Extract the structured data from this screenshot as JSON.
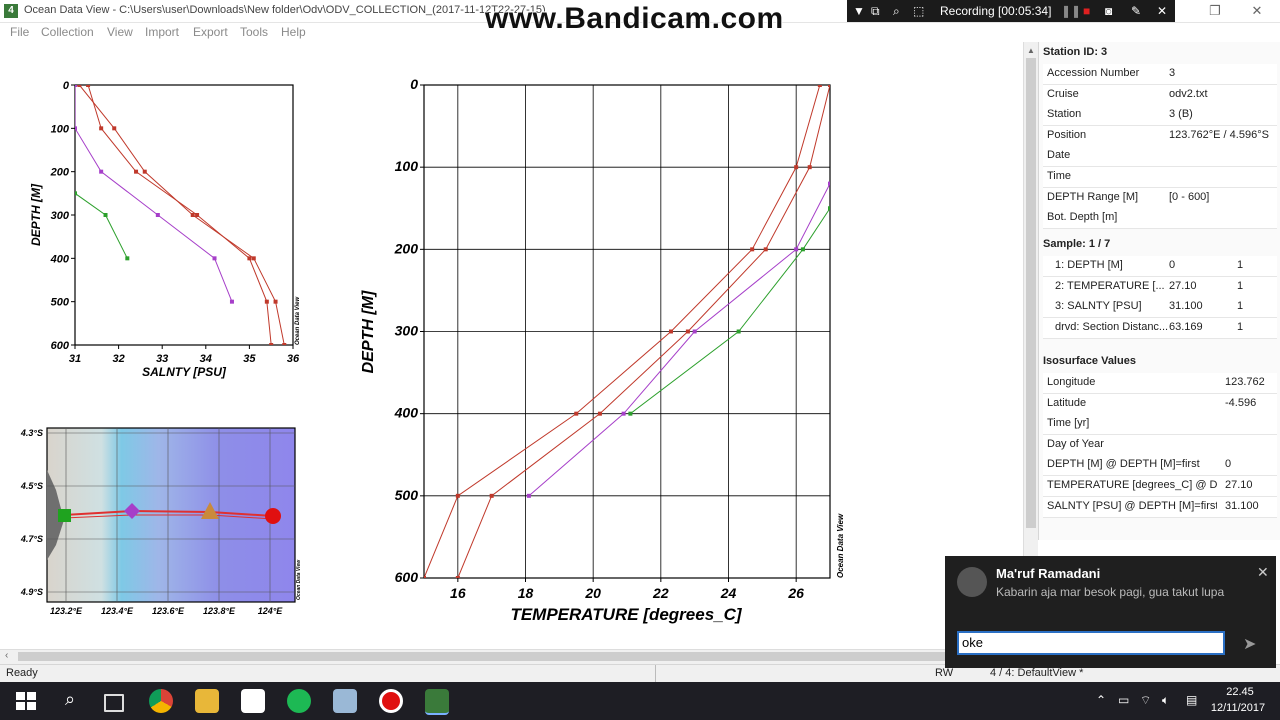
{
  "window": {
    "title": "Ocean Data View - C:\\Users\\user\\Downloads\\New folder\\Odv\\ODV_COLLECTION_(2017-11-12T22-27-15)",
    "app_icon": "4",
    "watermark": "www.Bandicam.com"
  },
  "recorder": {
    "label": "Recording [00:05:34]"
  },
  "menu": [
    "File",
    "Collection",
    "View",
    "Import",
    "Export",
    "Tools",
    "Help"
  ],
  "plots": {
    "salinity": {
      "ylabel": "DEPTH [M]",
      "xlabel": "SALNTY [PSU]",
      "watermark": "Ocean Data View",
      "xticks": [
        "31",
        "32",
        "33",
        "34",
        "35",
        "36"
      ],
      "yticks": [
        "0",
        "100",
        "200",
        "300",
        "400",
        "500",
        "600"
      ]
    },
    "temperature": {
      "ylabel": "DEPTH [M]",
      "xlabel": "TEMPERATURE [degrees_C]",
      "watermark": "Ocean Data View",
      "xticks": [
        "16",
        "18",
        "20",
        "22",
        "24",
        "26"
      ],
      "yticks": [
        "0",
        "100",
        "200",
        "300",
        "400",
        "500",
        "600"
      ]
    },
    "map": {
      "watermark": "Ocean Data View",
      "lat_ticks": [
        "4.3°S",
        "4.5°S",
        "4.7°S",
        "4.9°S"
      ],
      "lon_ticks": [
        "123.2°E",
        "123.4°E",
        "123.6°E",
        "123.8°E",
        "124°E"
      ]
    }
  },
  "chart_data": [
    {
      "type": "line",
      "xlabel": "SALNTY [PSU]",
      "ylabel": "DEPTH [M]",
      "xlim": [
        31,
        36
      ],
      "ylim": [
        600,
        0
      ],
      "series": [
        {
          "color": "#c0392b",
          "x": [
            31.1,
            31.9,
            32.6,
            33.7,
            35.1,
            35.6,
            35.8
          ],
          "y": [
            0,
            100,
            200,
            300,
            400,
            500,
            600
          ]
        },
        {
          "color": "#c0392b",
          "x": [
            31.3,
            31.6,
            32.4,
            33.8,
            35.0,
            35.4,
            35.5
          ],
          "y": [
            0,
            100,
            200,
            300,
            400,
            500,
            600
          ]
        },
        {
          "color": "#a63fc9",
          "x": [
            31.0,
            31.0,
            31.6,
            32.9,
            34.2,
            34.6
          ],
          "y": [
            0,
            100,
            200,
            300,
            400,
            500
          ]
        },
        {
          "color": "#2ca02c",
          "x": [
            31.0,
            31.7,
            32.2
          ],
          "y": [
            250,
            300,
            400
          ]
        }
      ]
    },
    {
      "type": "line",
      "xlabel": "TEMPERATURE [degrees_C]",
      "ylabel": "DEPTH [M]",
      "xlim": [
        15,
        27
      ],
      "ylim": [
        600,
        0
      ],
      "series": [
        {
          "color": "#c0392b",
          "x": [
            26.7,
            26.0,
            24.7,
            22.3,
            19.5,
            16.0,
            15.0
          ],
          "y": [
            0,
            100,
            200,
            300,
            400,
            500,
            600
          ]
        },
        {
          "color": "#c0392b",
          "x": [
            27.0,
            26.4,
            25.1,
            22.8,
            20.2,
            17.0,
            16.0
          ],
          "y": [
            0,
            100,
            200,
            300,
            400,
            500,
            600
          ]
        },
        {
          "color": "#a63fc9",
          "x": [
            27.0,
            26.0,
            23.0,
            20.9,
            18.1
          ],
          "y": [
            120,
            200,
            300,
            400,
            500
          ]
        },
        {
          "color": "#2ca02c",
          "x": [
            27.0,
            26.2,
            24.3,
            21.1
          ],
          "y": [
            150,
            200,
            300,
            400
          ]
        }
      ]
    }
  ],
  "panel": {
    "station_title": "Station ID: 3",
    "station_rows": [
      {
        "k": "Accession Number",
        "v": "3"
      },
      {
        "k": "Cruise",
        "v": "odv2.txt"
      },
      {
        "k": "Station",
        "v": "3 (B)"
      },
      {
        "k": "Position",
        "v": "123.762°E / 4.596°S"
      },
      {
        "k": "Date",
        "v": ""
      },
      {
        "k": "Time",
        "v": ""
      },
      {
        "k": "DEPTH Range [M]",
        "v": "[0 - 600]"
      },
      {
        "k": "Bot. Depth [m]",
        "v": ""
      }
    ],
    "sample_title": "Sample: 1 / 7",
    "sample_rows": [
      {
        "k": "1: DEPTH [M]",
        "v": "0",
        "c": "1"
      },
      {
        "k": "2: TEMPERATURE [...",
        "v": "27.10",
        "c": "1"
      },
      {
        "k": "3: SALNTY [PSU]",
        "v": "31.100",
        "c": "1"
      },
      {
        "k": "drvd: Section Distanc...",
        "v": "63.169",
        "c": "1"
      }
    ],
    "iso_title": "Isosurface Values",
    "iso_rows": [
      {
        "k": "Longitude",
        "v": "123.762"
      },
      {
        "k": "Latitude",
        "v": "-4.596"
      },
      {
        "k": "Time [yr]",
        "v": ""
      },
      {
        "k": "Day of Year",
        "v": ""
      },
      {
        "k": "DEPTH [M] @ DEPTH [M]=first",
        "v": "0"
      },
      {
        "k": "TEMPERATURE [degrees_C] @ D...",
        "v": "27.10"
      },
      {
        "k": "SALNTY [PSU] @ DEPTH [M]=first",
        "v": "31.100"
      }
    ]
  },
  "status": {
    "left": "Ready",
    "rw": "RW",
    "view": "4 / 4: DefaultView *"
  },
  "notification": {
    "sender": "Ma'ruf Ramadani",
    "message": "Kabarin aja mar besok pagi, gua takut lupa",
    "reply_value": "oke"
  },
  "taskbar": {
    "time": "22.45",
    "date": "12/11/2017"
  }
}
